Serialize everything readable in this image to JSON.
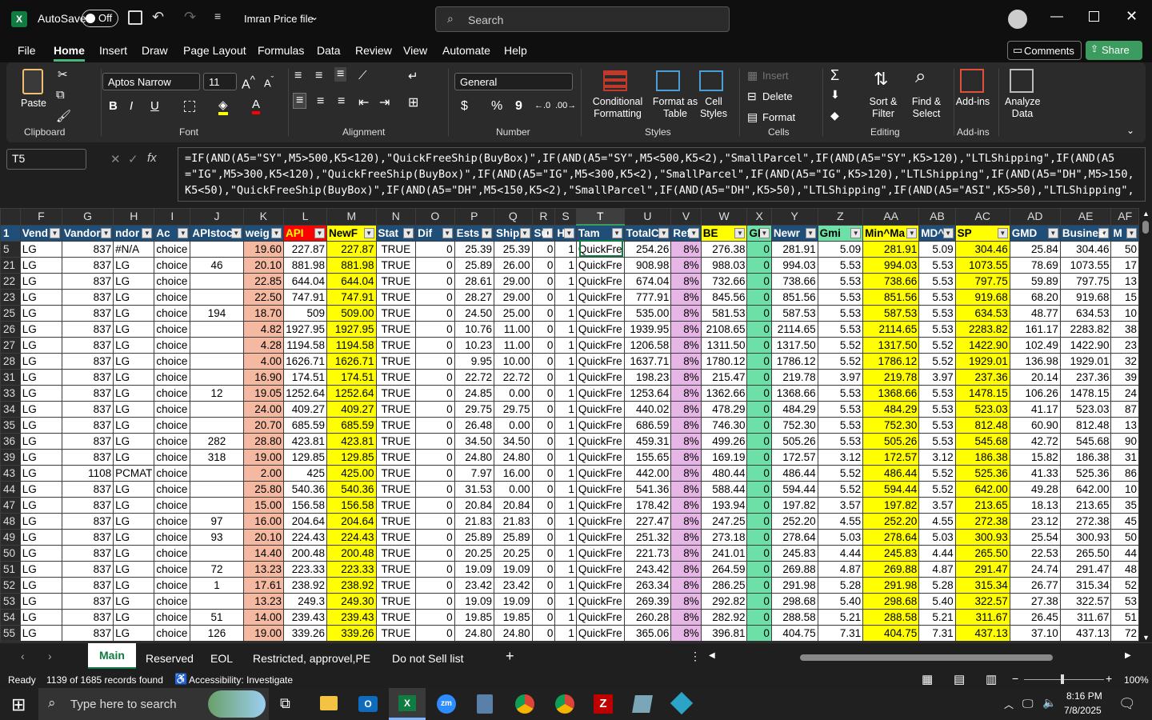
{
  "title": {
    "autosave": "AutoSave",
    "autosave_state": "Off",
    "filename": "Imran Price file",
    "search": "Search"
  },
  "ribbon_tabs": [
    "File",
    "Home",
    "Insert",
    "Draw",
    "Page Layout",
    "Formulas",
    "Data",
    "Review",
    "View",
    "Automate",
    "Help"
  ],
  "ribbon_right": {
    "comments": "Comments",
    "share": "Share"
  },
  "ribbon": {
    "clipboard": {
      "paste": "Paste",
      "label": "Clipboard"
    },
    "font": {
      "name": "Aptos Narrow",
      "size": "11",
      "label": "Font",
      "bold": "B",
      "italic": "I",
      "underline": "U"
    },
    "alignment": {
      "label": "Alignment"
    },
    "number": {
      "format": "General",
      "label": "Number",
      "currency": "$",
      "percent": "%",
      "comma": "9"
    },
    "styles": {
      "cond": "Conditional Formatting",
      "table": "Format as Table",
      "cell": "Cell Styles",
      "label": "Styles"
    },
    "cells": {
      "insert": "Insert",
      "delete": "Delete",
      "format": "Format",
      "label": "Cells"
    },
    "editing": {
      "sort": "Sort & Filter",
      "find": "Find & Select",
      "label": "Editing"
    },
    "addins": {
      "addins": "Add-ins",
      "label": "Add-ins",
      "analyze": "Analyze Data"
    }
  },
  "formula_bar": {
    "namebox": "T5",
    "fx": "fx",
    "line1": "=IF(AND(A5=\"SY\",M5>500,K5<120),\"QuickFreeShip(BuyBox)\",IF(AND(A5=\"SY\",M5<500,K5<2),\"SmallParcel\",IF(AND(A5=\"SY\",K5>120),\"LTLShipping\",IF(AND(A5",
    "line2": "=\"IG\",M5>300,K5<120),\"QuickFreeShip(BuyBox)\",IF(AND(A5=\"IG\",M5<300,K5<2),\"SmallParcel\",IF(AND(A5=\"IG\",K5>120),\"LTLShipping\",IF(AND(A5=\"DH\",M5>150,",
    "line3": "K5<50),\"QuickFreeShip(BuyBox)\",IF(AND(A5=\"DH\",M5<150,K5<2),\"SmallParcel\",IF(AND(A5=\"DH\",K5>50),\"LTLShipping\",IF(AND(A5=\"ASI\",K5>50),\"LTLShipping\","
  },
  "columns": [
    "F",
    "G",
    "H",
    "I",
    "J",
    "K",
    "L",
    "M",
    "N",
    "O",
    "P",
    "Q",
    "R",
    "S",
    "T",
    "U",
    "V",
    "W",
    "X",
    "Y",
    "Z",
    "AA",
    "AB",
    "AC",
    "AD",
    "AE",
    "AF"
  ],
  "headers": [
    "Vend",
    "Vandor",
    "ndor",
    "Ac",
    "APIstoc",
    "weig",
    "API",
    "NewF",
    "Stat",
    "Dif",
    "Ests",
    "Ship",
    "Sui",
    "H",
    "Tam",
    "TotalC",
    "Ref",
    "BE",
    "GI",
    "Newr",
    "Gmi",
    "Min^Ma",
    "MD^",
    "SP",
    "GMD",
    "Busines",
    "M"
  ],
  "rows": [
    [
      "5",
      "LG",
      "837",
      "#N/A",
      "choice",
      "",
      "19.60",
      "227.87",
      "227.87",
      "TRUE",
      "0",
      "25.39",
      "25.39",
      "0",
      "1",
      "QuickFre",
      "254.26",
      "8%",
      "276.38",
      "0",
      "281.91",
      "5.09",
      "281.91",
      "5.09",
      "304.46",
      "25.84",
      "304.46",
      "50"
    ],
    [
      "21",
      "LG",
      "837",
      "LG",
      "choice",
      "46",
      "20.10",
      "881.98",
      "881.98",
      "TRUE",
      "0",
      "25.89",
      "26.00",
      "0",
      "1",
      "QuickFre",
      "908.98",
      "8%",
      "988.03",
      "0",
      "994.03",
      "5.53",
      "994.03",
      "5.53",
      "1073.55",
      "78.69",
      "1073.55",
      "17"
    ],
    [
      "22",
      "LG",
      "837",
      "LG",
      "choice",
      "",
      "22.85",
      "644.04",
      "644.04",
      "TRUE",
      "0",
      "28.61",
      "29.00",
      "0",
      "1",
      "QuickFre",
      "674.04",
      "8%",
      "732.66",
      "0",
      "738.66",
      "5.53",
      "738.66",
      "5.53",
      "797.75",
      "59.89",
      "797.75",
      "13"
    ],
    [
      "23",
      "LG",
      "837",
      "LG",
      "choice",
      "",
      "22.50",
      "747.91",
      "747.91",
      "TRUE",
      "0",
      "28.27",
      "29.00",
      "0",
      "1",
      "QuickFre",
      "777.91",
      "8%",
      "845.56",
      "0",
      "851.56",
      "5.53",
      "851.56",
      "5.53",
      "919.68",
      "68.20",
      "919.68",
      "15"
    ],
    [
      "25",
      "LG",
      "837",
      "LG",
      "choice",
      "194",
      "18.70",
      "509",
      "509.00",
      "TRUE",
      "0",
      "24.50",
      "25.00",
      "0",
      "1",
      "QuickFre",
      "535.00",
      "8%",
      "581.53",
      "0",
      "587.53",
      "5.53",
      "587.53",
      "5.53",
      "634.53",
      "48.77",
      "634.53",
      "10"
    ],
    [
      "26",
      "LG",
      "837",
      "LG",
      "choice",
      "",
      "4.82",
      "1927.95",
      "1927.95",
      "TRUE",
      "0",
      "10.76",
      "11.00",
      "0",
      "1",
      "QuickFre",
      "1939.95",
      "8%",
      "2108.65",
      "0",
      "2114.65",
      "5.53",
      "2114.65",
      "5.53",
      "2283.82",
      "161.17",
      "2283.82",
      "38"
    ],
    [
      "27",
      "LG",
      "837",
      "LG",
      "choice",
      "",
      "4.28",
      "1194.58",
      "1194.58",
      "TRUE",
      "0",
      "10.23",
      "11.00",
      "0",
      "1",
      "QuickFre",
      "1206.58",
      "8%",
      "1311.50",
      "0",
      "1317.50",
      "5.52",
      "1317.50",
      "5.52",
      "1422.90",
      "102.49",
      "1422.90",
      "23"
    ],
    [
      "28",
      "LG",
      "837",
      "LG",
      "choice",
      "",
      "4.00",
      "1626.71",
      "1626.71",
      "TRUE",
      "0",
      "9.95",
      "10.00",
      "0",
      "1",
      "QuickFre",
      "1637.71",
      "8%",
      "1780.12",
      "0",
      "1786.12",
      "5.52",
      "1786.12",
      "5.52",
      "1929.01",
      "136.98",
      "1929.01",
      "32"
    ],
    [
      "31",
      "LG",
      "837",
      "LG",
      "choice",
      "",
      "16.90",
      "174.51",
      "174.51",
      "TRUE",
      "0",
      "22.72",
      "22.72",
      "0",
      "1",
      "QuickFre",
      "198.23",
      "8%",
      "215.47",
      "0",
      "219.78",
      "3.97",
      "219.78",
      "3.97",
      "237.36",
      "20.14",
      "237.36",
      "39"
    ],
    [
      "33",
      "LG",
      "837",
      "LG",
      "choice",
      "12",
      "19.05",
      "1252.64",
      "1252.64",
      "TRUE",
      "0",
      "24.85",
      "0.00",
      "0",
      "1",
      "QuickFre",
      "1253.64",
      "8%",
      "1362.66",
      "0",
      "1368.66",
      "5.53",
      "1368.66",
      "5.53",
      "1478.15",
      "106.26",
      "1478.15",
      "24"
    ],
    [
      "34",
      "LG",
      "837",
      "LG",
      "choice",
      "",
      "24.00",
      "409.27",
      "409.27",
      "TRUE",
      "0",
      "29.75",
      "29.75",
      "0",
      "1",
      "QuickFre",
      "440.02",
      "8%",
      "478.29",
      "0",
      "484.29",
      "5.53",
      "484.29",
      "5.53",
      "523.03",
      "41.17",
      "523.03",
      "87"
    ],
    [
      "35",
      "LG",
      "837",
      "LG",
      "choice",
      "",
      "20.70",
      "685.59",
      "685.59",
      "TRUE",
      "0",
      "26.48",
      "0.00",
      "0",
      "1",
      "QuickFre",
      "686.59",
      "8%",
      "746.30",
      "0",
      "752.30",
      "5.53",
      "752.30",
      "5.53",
      "812.48",
      "60.90",
      "812.48",
      "13"
    ],
    [
      "36",
      "LG",
      "837",
      "LG",
      "choice",
      "282",
      "28.80",
      "423.81",
      "423.81",
      "TRUE",
      "0",
      "34.50",
      "34.50",
      "0",
      "1",
      "QuickFre",
      "459.31",
      "8%",
      "499.26",
      "0",
      "505.26",
      "5.53",
      "505.26",
      "5.53",
      "545.68",
      "42.72",
      "545.68",
      "90"
    ],
    [
      "39",
      "LG",
      "837",
      "LG",
      "choice",
      "318",
      "19.00",
      "129.85",
      "129.85",
      "TRUE",
      "0",
      "24.80",
      "24.80",
      "0",
      "1",
      "QuickFre",
      "155.65",
      "8%",
      "169.19",
      "0",
      "172.57",
      "3.12",
      "172.57",
      "3.12",
      "186.38",
      "15.82",
      "186.38",
      "31"
    ],
    [
      "43",
      "LG",
      "1108",
      "PCMAT",
      "choice",
      "",
      "2.00",
      "425",
      "425.00",
      "TRUE",
      "0",
      "7.97",
      "16.00",
      "0",
      "1",
      "QuickFre",
      "442.00",
      "8%",
      "480.44",
      "0",
      "486.44",
      "5.52",
      "486.44",
      "5.52",
      "525.36",
      "41.33",
      "525.36",
      "86"
    ],
    [
      "44",
      "LG",
      "837",
      "LG",
      "choice",
      "",
      "25.80",
      "540.36",
      "540.36",
      "TRUE",
      "0",
      "31.53",
      "0.00",
      "0",
      "1",
      "QuickFre",
      "541.36",
      "8%",
      "588.44",
      "0",
      "594.44",
      "5.52",
      "594.44",
      "5.52",
      "642.00",
      "49.28",
      "642.00",
      "10"
    ],
    [
      "47",
      "LG",
      "837",
      "LG",
      "choice",
      "",
      "15.00",
      "156.58",
      "156.58",
      "TRUE",
      "0",
      "20.84",
      "20.84",
      "0",
      "1",
      "QuickFre",
      "178.42",
      "8%",
      "193.94",
      "0",
      "197.82",
      "3.57",
      "197.82",
      "3.57",
      "213.65",
      "18.13",
      "213.65",
      "35"
    ],
    [
      "48",
      "LG",
      "837",
      "LG",
      "choice",
      "97",
      "16.00",
      "204.64",
      "204.64",
      "TRUE",
      "0",
      "21.83",
      "21.83",
      "0",
      "1",
      "QuickFre",
      "227.47",
      "8%",
      "247.25",
      "0",
      "252.20",
      "4.55",
      "252.20",
      "4.55",
      "272.38",
      "23.12",
      "272.38",
      "45"
    ],
    [
      "49",
      "LG",
      "837",
      "LG",
      "choice",
      "93",
      "20.10",
      "224.43",
      "224.43",
      "TRUE",
      "0",
      "25.89",
      "25.89",
      "0",
      "1",
      "QuickFre",
      "251.32",
      "8%",
      "273.18",
      "0",
      "278.64",
      "5.03",
      "278.64",
      "5.03",
      "300.93",
      "25.54",
      "300.93",
      "50"
    ],
    [
      "50",
      "LG",
      "837",
      "LG",
      "choice",
      "",
      "14.40",
      "200.48",
      "200.48",
      "TRUE",
      "0",
      "20.25",
      "20.25",
      "0",
      "1",
      "QuickFre",
      "221.73",
      "8%",
      "241.01",
      "0",
      "245.83",
      "4.44",
      "245.83",
      "4.44",
      "265.50",
      "22.53",
      "265.50",
      "44"
    ],
    [
      "51",
      "LG",
      "837",
      "LG",
      "choice",
      "72",
      "13.23",
      "223.33",
      "223.33",
      "TRUE",
      "0",
      "19.09",
      "19.09",
      "0",
      "1",
      "QuickFre",
      "243.42",
      "8%",
      "264.59",
      "0",
      "269.88",
      "4.87",
      "269.88",
      "4.87",
      "291.47",
      "24.74",
      "291.47",
      "48"
    ],
    [
      "52",
      "LG",
      "837",
      "LG",
      "choice",
      "1",
      "17.61",
      "238.92",
      "238.92",
      "TRUE",
      "0",
      "23.42",
      "23.42",
      "0",
      "1",
      "QuickFre",
      "263.34",
      "8%",
      "286.25",
      "0",
      "291.98",
      "5.28",
      "291.98",
      "5.28",
      "315.34",
      "26.77",
      "315.34",
      "52"
    ],
    [
      "53",
      "LG",
      "837",
      "LG",
      "choice",
      "",
      "13.23",
      "249.3",
      "249.30",
      "TRUE",
      "0",
      "19.09",
      "19.09",
      "0",
      "1",
      "QuickFre",
      "269.39",
      "8%",
      "292.82",
      "0",
      "298.68",
      "5.40",
      "298.68",
      "5.40",
      "322.57",
      "27.38",
      "322.57",
      "53"
    ],
    [
      "54",
      "LG",
      "837",
      "LG",
      "choice",
      "51",
      "14.00",
      "239.43",
      "239.43",
      "TRUE",
      "0",
      "19.85",
      "19.85",
      "0",
      "1",
      "QuickFre",
      "260.28",
      "8%",
      "282.92",
      "0",
      "288.58",
      "5.21",
      "288.58",
      "5.21",
      "311.67",
      "26.45",
      "311.67",
      "51"
    ],
    [
      "55",
      "LG",
      "837",
      "LG",
      "choice",
      "126",
      "19.00",
      "339.26",
      "339.26",
      "TRUE",
      "0",
      "24.80",
      "24.80",
      "0",
      "1",
      "QuickFre",
      "365.06",
      "8%",
      "396.81",
      "0",
      "404.75",
      "7.31",
      "404.75",
      "7.31",
      "437.13",
      "37.10",
      "437.13",
      "72"
    ]
  ],
  "sheet_tabs": [
    "Main",
    "Reserved",
    "EOL",
    "Restricted, approvel,PE",
    "Do not Sell list"
  ],
  "status": {
    "ready": "Ready",
    "records": "1139 of 1685 records found",
    "accessibility": "Accessibility: Investigate",
    "zoom": "100%"
  },
  "taskbar": {
    "search": "Type here to search",
    "time": "8:16 PM",
    "date": "7/8/2025"
  },
  "colors": {
    "accent": "#107c41",
    "header": "#1f4e78",
    "yellow": "#ffff00",
    "salmon": "#f4b9a0",
    "pink": "#e6b6e6",
    "green": "#6ce0a6"
  }
}
